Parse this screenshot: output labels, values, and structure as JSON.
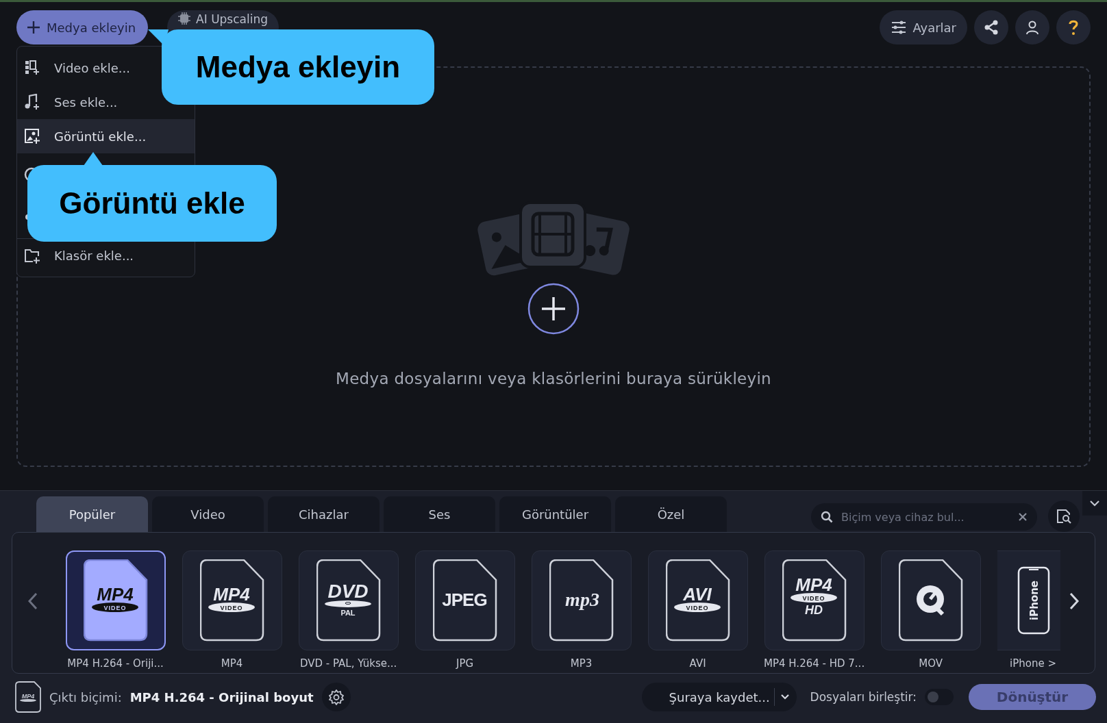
{
  "toolbar": {
    "add_button": "Medya ekleyin",
    "ai_button": "AI Upscaling",
    "settings_button": "Ayarlar"
  },
  "add_menu": [
    {
      "label": "Video ekle...",
      "selected": false,
      "kind": "video"
    },
    {
      "label": "Ses ekle...",
      "selected": false,
      "kind": "audio"
    },
    {
      "label": "Görüntü ekle...",
      "selected": true,
      "kind": "image"
    },
    {
      "kind": "covered-disc"
    },
    {
      "kind": "covered-dot"
    },
    {
      "label": "Klasör ekle...",
      "selected": false,
      "kind": "folder"
    }
  ],
  "callouts": [
    {
      "text": "Medya ekleyin"
    },
    {
      "text": "Görüntü ekle"
    }
  ],
  "drop_zone": {
    "hint": "Medya dosyalarını veya klasörlerini buraya sürükleyin"
  },
  "format_tabs": [
    {
      "label": "Popüler",
      "selected": true
    },
    {
      "label": "Video",
      "selected": false
    },
    {
      "label": "Cihazlar",
      "selected": false
    },
    {
      "label": "Ses",
      "selected": false
    },
    {
      "label": "Görüntüler",
      "selected": false
    },
    {
      "label": "Özel",
      "selected": false
    }
  ],
  "search": {
    "placeholder": "Biçim veya cihaz bul..."
  },
  "formats": [
    {
      "label": "MP4 H.264 - Oriji...",
      "selected": true,
      "kind": "badge",
      "logo": "MP4",
      "badge": "VIDEO"
    },
    {
      "label": "MP4",
      "selected": false,
      "kind": "badge",
      "logo": "MP4",
      "badge": "VIDEO"
    },
    {
      "label": "DVD - PAL, Yükse...",
      "selected": false,
      "kind": "disc",
      "logo": "DVD",
      "extra": "PAL"
    },
    {
      "label": "JPG",
      "selected": false,
      "kind": "plain",
      "logo": "JPEG"
    },
    {
      "label": "MP3",
      "selected": false,
      "kind": "script",
      "logo": "mp3"
    },
    {
      "label": "AVI",
      "selected": false,
      "kind": "badge",
      "logo": "AVI",
      "badge": "VIDEO"
    },
    {
      "label": "MP4 H.264 - HD 7...",
      "selected": false,
      "kind": "badge",
      "logo": "MP4",
      "badge": "VIDEO",
      "extra": "HD"
    },
    {
      "label": "MOV",
      "selected": false,
      "kind": "quicktime"
    },
    {
      "label": "iPhone >",
      "selected": false,
      "kind": "phone",
      "logo": "iPhone"
    }
  ],
  "output": {
    "icon_logo": "MP4",
    "label": "Çıktı biçimi:",
    "value": "MP4 H.264 - Orijinal boyut"
  },
  "save_button": "Şuraya kaydet...",
  "merge": {
    "label": "Dosyaları birleştir:",
    "on": false
  },
  "convert_button": {
    "label": "Dönüştür",
    "disabled": true
  }
}
